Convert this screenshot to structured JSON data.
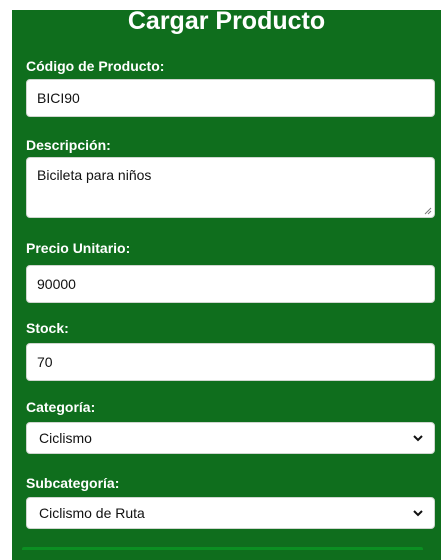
{
  "form": {
    "title": "Cargar Producto",
    "codigo": {
      "label": "Código de Producto:",
      "value": "BICI90"
    },
    "descripcion": {
      "label": "Descripción:",
      "value": "Bicileta para niños"
    },
    "precio": {
      "label": "Precio Unitario:",
      "value": "90000"
    },
    "stock": {
      "label": "Stock:",
      "value": "70"
    },
    "categoria": {
      "label": "Categoría:",
      "selected": "Ciclismo"
    },
    "subcategoria": {
      "label": "Subcategoría:",
      "selected": "Ciclismo de Ruta"
    }
  },
  "colors": {
    "panel_bg": "#0f6e1d",
    "field_bg": "#ffffff",
    "label_text": "#ffffff"
  },
  "icons": {
    "select_arrow": "chevron-down-icon",
    "textarea_resize": "resize-handle-icon"
  }
}
